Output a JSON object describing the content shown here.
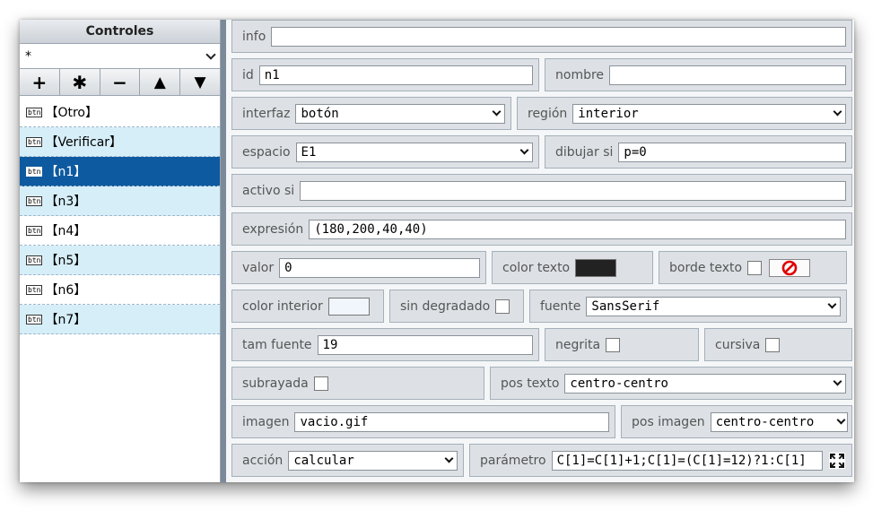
{
  "left_panel": {
    "title": "Controles",
    "filter_value": "*",
    "buttons": {
      "add": "+",
      "duplicate": "✱",
      "remove": "−",
      "up": "▲",
      "down": "▼"
    },
    "items": [
      {
        "badge": "btn",
        "label": "【Otro】"
      },
      {
        "badge": "btn",
        "label": "【Verificar】"
      },
      {
        "badge": "btn",
        "label": "【n1】"
      },
      {
        "badge": "btn",
        "label": "【n3】"
      },
      {
        "badge": "btn",
        "label": "【n4】"
      },
      {
        "badge": "btn",
        "label": "【n5】"
      },
      {
        "badge": "btn",
        "label": "【n6】"
      },
      {
        "badge": "btn",
        "label": "【n7】"
      }
    ],
    "selected_index": 2
  },
  "form": {
    "info": {
      "label": "info",
      "value": ""
    },
    "id": {
      "label": "id",
      "value": "n1"
    },
    "nombre": {
      "label": "nombre",
      "value": ""
    },
    "interfaz": {
      "label": "interfaz",
      "value": "botón"
    },
    "region": {
      "label": "región",
      "value": "interior"
    },
    "espacio": {
      "label": "espacio",
      "value": "E1"
    },
    "dibujar_si": {
      "label": "dibujar si",
      "value": "p=0"
    },
    "activo_si": {
      "label": "activo si",
      "value": ""
    },
    "expresion": {
      "label": "expresión",
      "value": "(180,200,40,40)"
    },
    "valor": {
      "label": "valor",
      "value": "0"
    },
    "color_texto": {
      "label": "color texto",
      "color": "#222222"
    },
    "borde_texto": {
      "label": "borde texto",
      "checked": false
    },
    "color_interior": {
      "label": "color interior",
      "color": "#f0f6fc"
    },
    "sin_degradado": {
      "label": "sin degradado",
      "checked": false
    },
    "fuente": {
      "label": "fuente",
      "value": "SansSerif"
    },
    "tam_fuente": {
      "label": "tam fuente",
      "value": "19"
    },
    "negrita": {
      "label": "negrita",
      "checked": false
    },
    "cursiva": {
      "label": "cursiva",
      "checked": false
    },
    "subrayada": {
      "label": "subrayada",
      "checked": false
    },
    "pos_texto": {
      "label": "pos texto",
      "value": "centro-centro"
    },
    "imagen": {
      "label": "imagen",
      "value": "vacio.gif"
    },
    "pos_imagen": {
      "label": "pos imagen",
      "value": "centro-centro"
    },
    "accion": {
      "label": "acción",
      "value": "calcular"
    },
    "parametro": {
      "label": "parámetro",
      "value": "C[1]=C[1]+1;C[1]=(C[1]=12)?1:C[1]"
    }
  },
  "colors": {
    "selected": "#0d5aa0",
    "alt_row": "#d6eef8",
    "panel_bg": "#dde1e5",
    "no_icon": "#e00000"
  }
}
